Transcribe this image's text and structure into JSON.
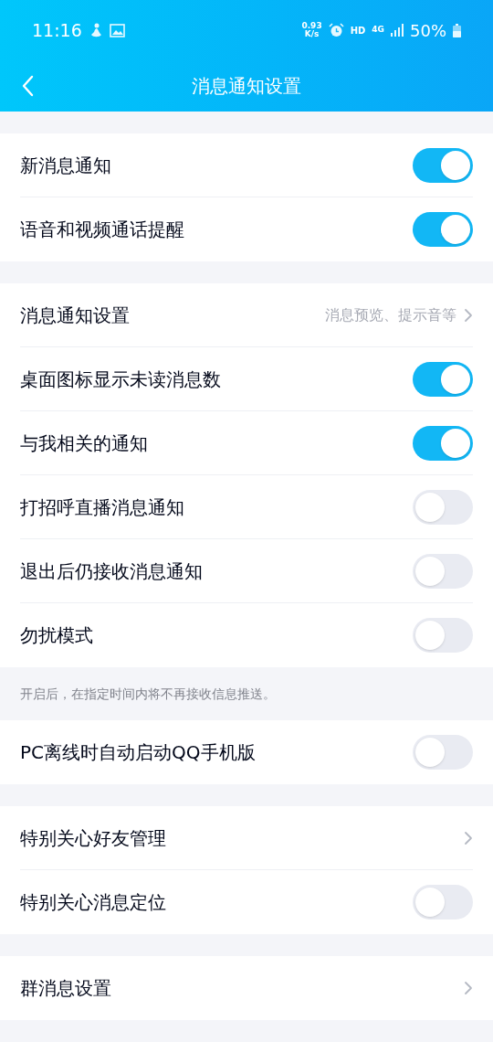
{
  "status_bar": {
    "time": "11:16",
    "speed_value": "0.93",
    "speed_unit": "K/s",
    "hd": "HD",
    "network": "4G",
    "battery": "50%"
  },
  "header": {
    "title": "消息通知设置"
  },
  "groups": [
    {
      "rows": [
        {
          "kind": "toggle",
          "label": "新消息通知",
          "on": true
        },
        {
          "kind": "toggle",
          "label": "语音和视频通话提醒",
          "on": true
        }
      ]
    },
    {
      "rows": [
        {
          "kind": "link",
          "label": "消息通知设置",
          "value": "消息预览、提示音等"
        },
        {
          "kind": "toggle",
          "label": "桌面图标显示未读消息数",
          "on": true
        },
        {
          "kind": "toggle",
          "label": "与我相关的通知",
          "on": true
        },
        {
          "kind": "toggle",
          "label": "打招呼直播消息通知",
          "on": false
        },
        {
          "kind": "toggle",
          "label": "退出后仍接收消息通知",
          "on": false
        },
        {
          "kind": "toggle",
          "label": "勿扰模式",
          "on": false
        }
      ],
      "note": "开启后，在指定时间内将不再接收信息推送。"
    },
    {
      "rows": [
        {
          "kind": "toggle",
          "label": "PC离线时自动启动QQ手机版",
          "on": false
        }
      ]
    },
    {
      "rows": [
        {
          "kind": "link",
          "label": "特别关心好友管理"
        },
        {
          "kind": "toggle",
          "label": "特别关心消息定位",
          "on": false
        }
      ]
    },
    {
      "rows": [
        {
          "kind": "link",
          "label": "群消息设置"
        }
      ]
    }
  ]
}
